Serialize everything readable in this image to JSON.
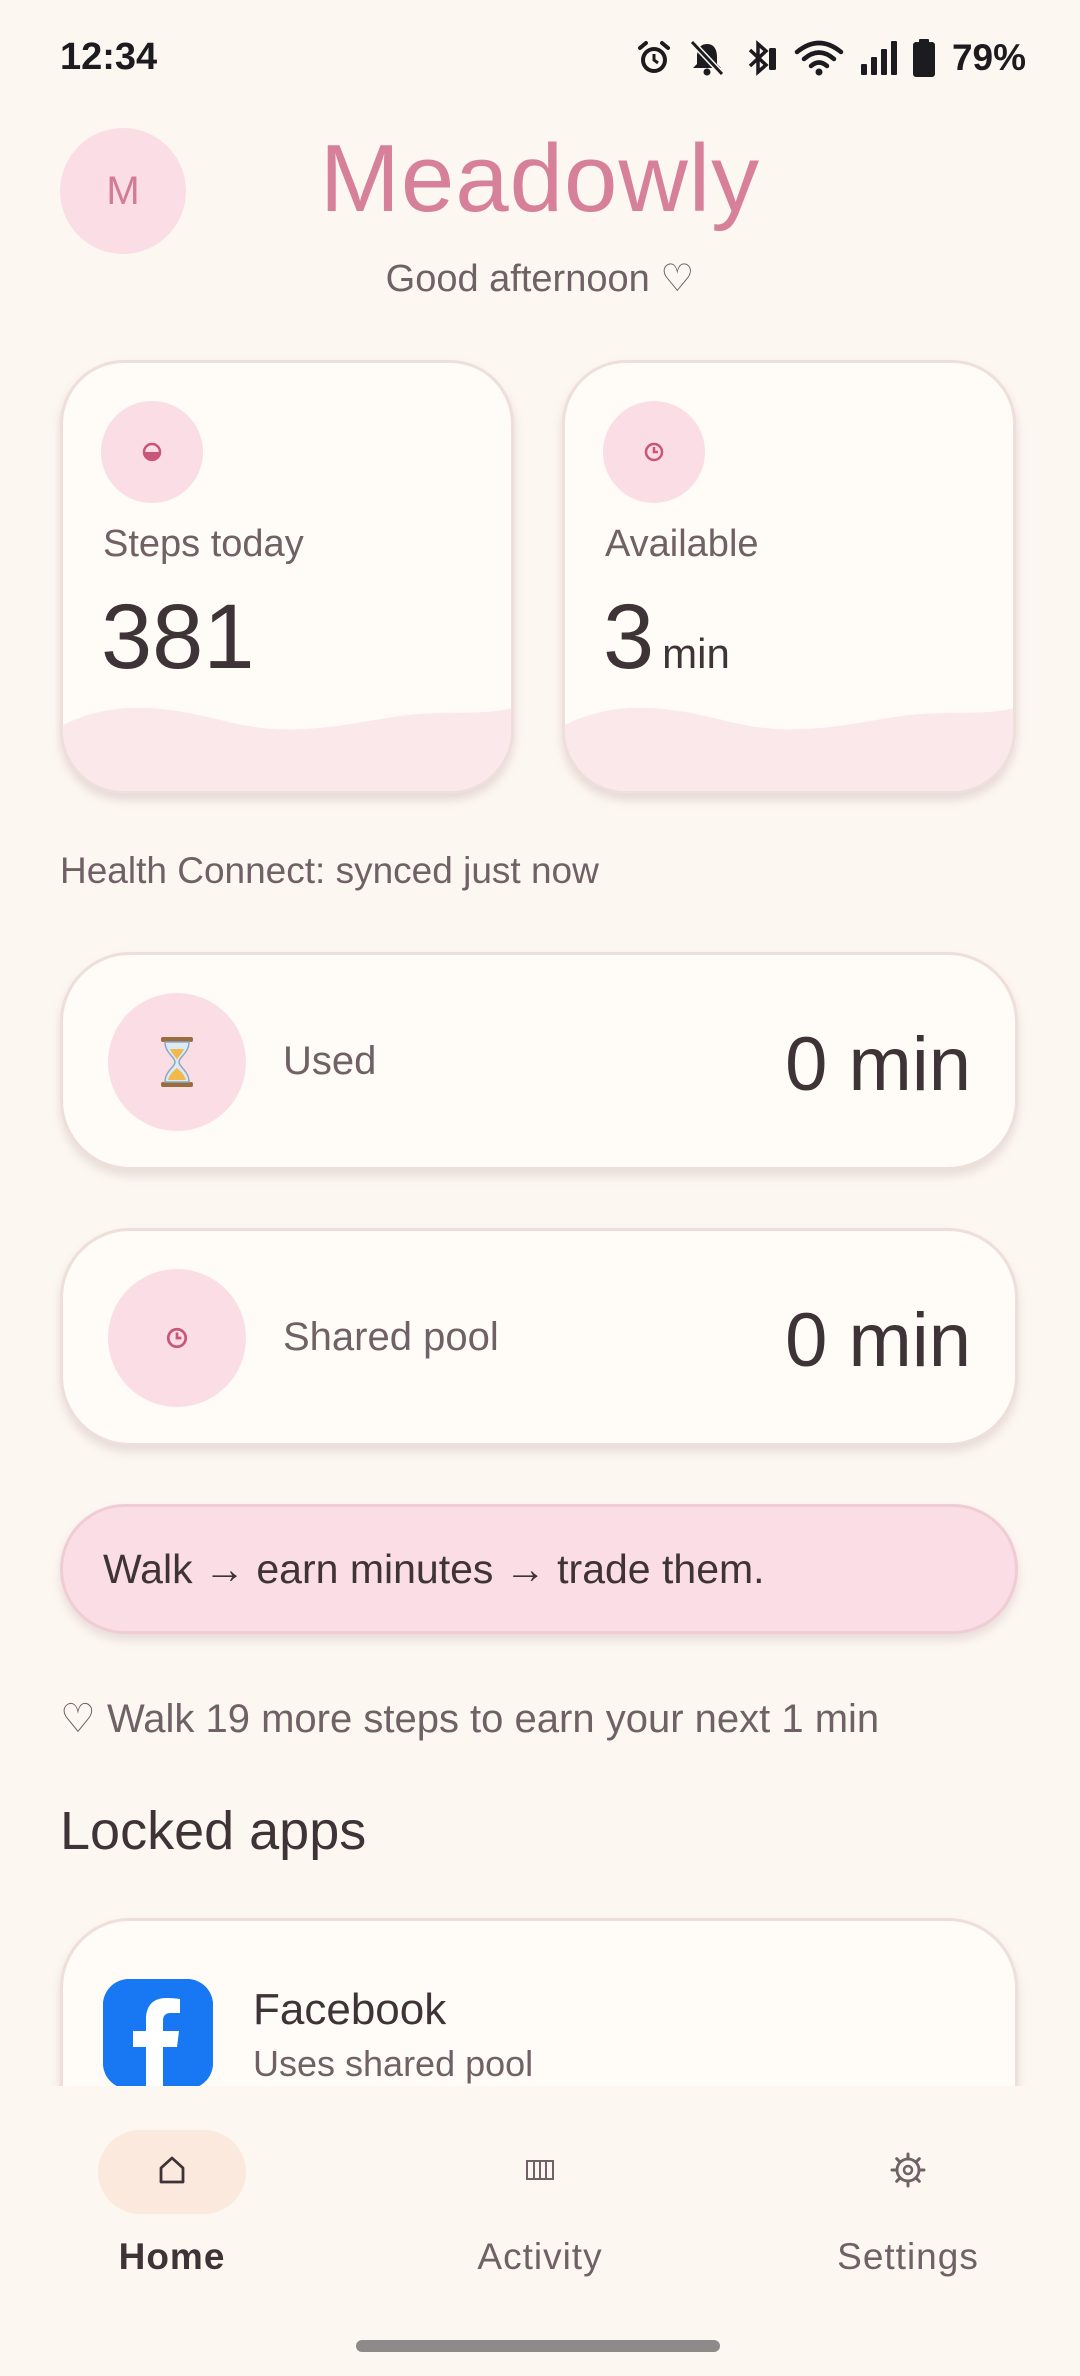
{
  "status_bar": {
    "time": "12:34",
    "battery": "79%",
    "icons": [
      "alarm-icon",
      "bell-off-icon",
      "bluetooth-icon",
      "wifi-icon",
      "signal-icon",
      "battery-icon"
    ]
  },
  "header": {
    "avatar_letter": "M",
    "title": "Meadowly",
    "greeting": "Good afternoon ♡"
  },
  "stats": {
    "steps": {
      "label": "Steps today",
      "value": "381",
      "icon": "half-circle-icon"
    },
    "available": {
      "label": "Available",
      "value": "3",
      "unit": "min",
      "icon": "clock-icon"
    }
  },
  "sync_status": "Health Connect: synced just now",
  "used": {
    "label": "Used",
    "value": "0 min",
    "icon": "hourglass-icon"
  },
  "shared_pool": {
    "label": "Shared pool",
    "value": "0 min",
    "icon": "clock-icon"
  },
  "banner": "Walk → earn minutes → trade them.",
  "hint": "♡ Walk 19 more steps to earn your next 1 min",
  "locked_apps": {
    "title": "Locked apps",
    "items": [
      {
        "name": "Facebook",
        "subtitle": "Uses shared pool",
        "icon": "facebook-icon"
      }
    ]
  },
  "nav": {
    "items": [
      {
        "label": "Home",
        "icon": "home-icon",
        "selected": true
      },
      {
        "label": "Activity",
        "icon": "bars-icon",
        "selected": false
      },
      {
        "label": "Settings",
        "icon": "gear-icon",
        "selected": false
      }
    ]
  },
  "colors": {
    "background": "#FDF7F2",
    "accent_pink": "#D6809A",
    "soft_pink": "#FBDDE5",
    "card": "#FFFBF7",
    "facebook_blue": "#1877F2"
  }
}
